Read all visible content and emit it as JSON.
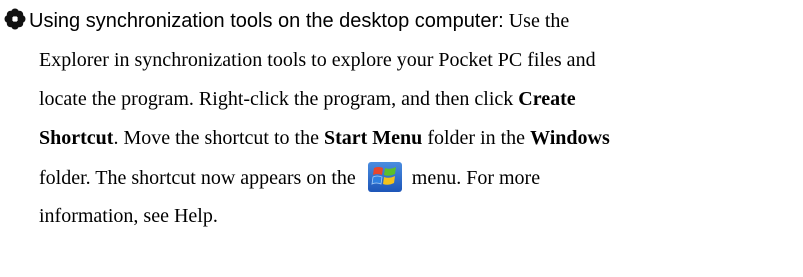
{
  "section": {
    "heading": "Using synchronization tools on the desktop computer",
    "heading_colon": ":",
    "line1_rest": " Use the",
    "line2": "Explorer in synchronization tools to explore your Pocket PC files and",
    "line3_a": "locate the program. Right-click the program, and then click ",
    "line3_b": "Create",
    "line4_a": "Shortcut",
    "line4_b": ". Move the shortcut to the ",
    "line4_c": "Start Menu",
    "line4_d": " folder in the ",
    "line4_e": "Windows",
    "line5_a": "folder. The shortcut now appears on the",
    "line5_b": "menu. For more",
    "line6": "information, see Help."
  },
  "icons": {
    "bullet": "flower-bullet-icon",
    "start": "windows-start-icon"
  }
}
